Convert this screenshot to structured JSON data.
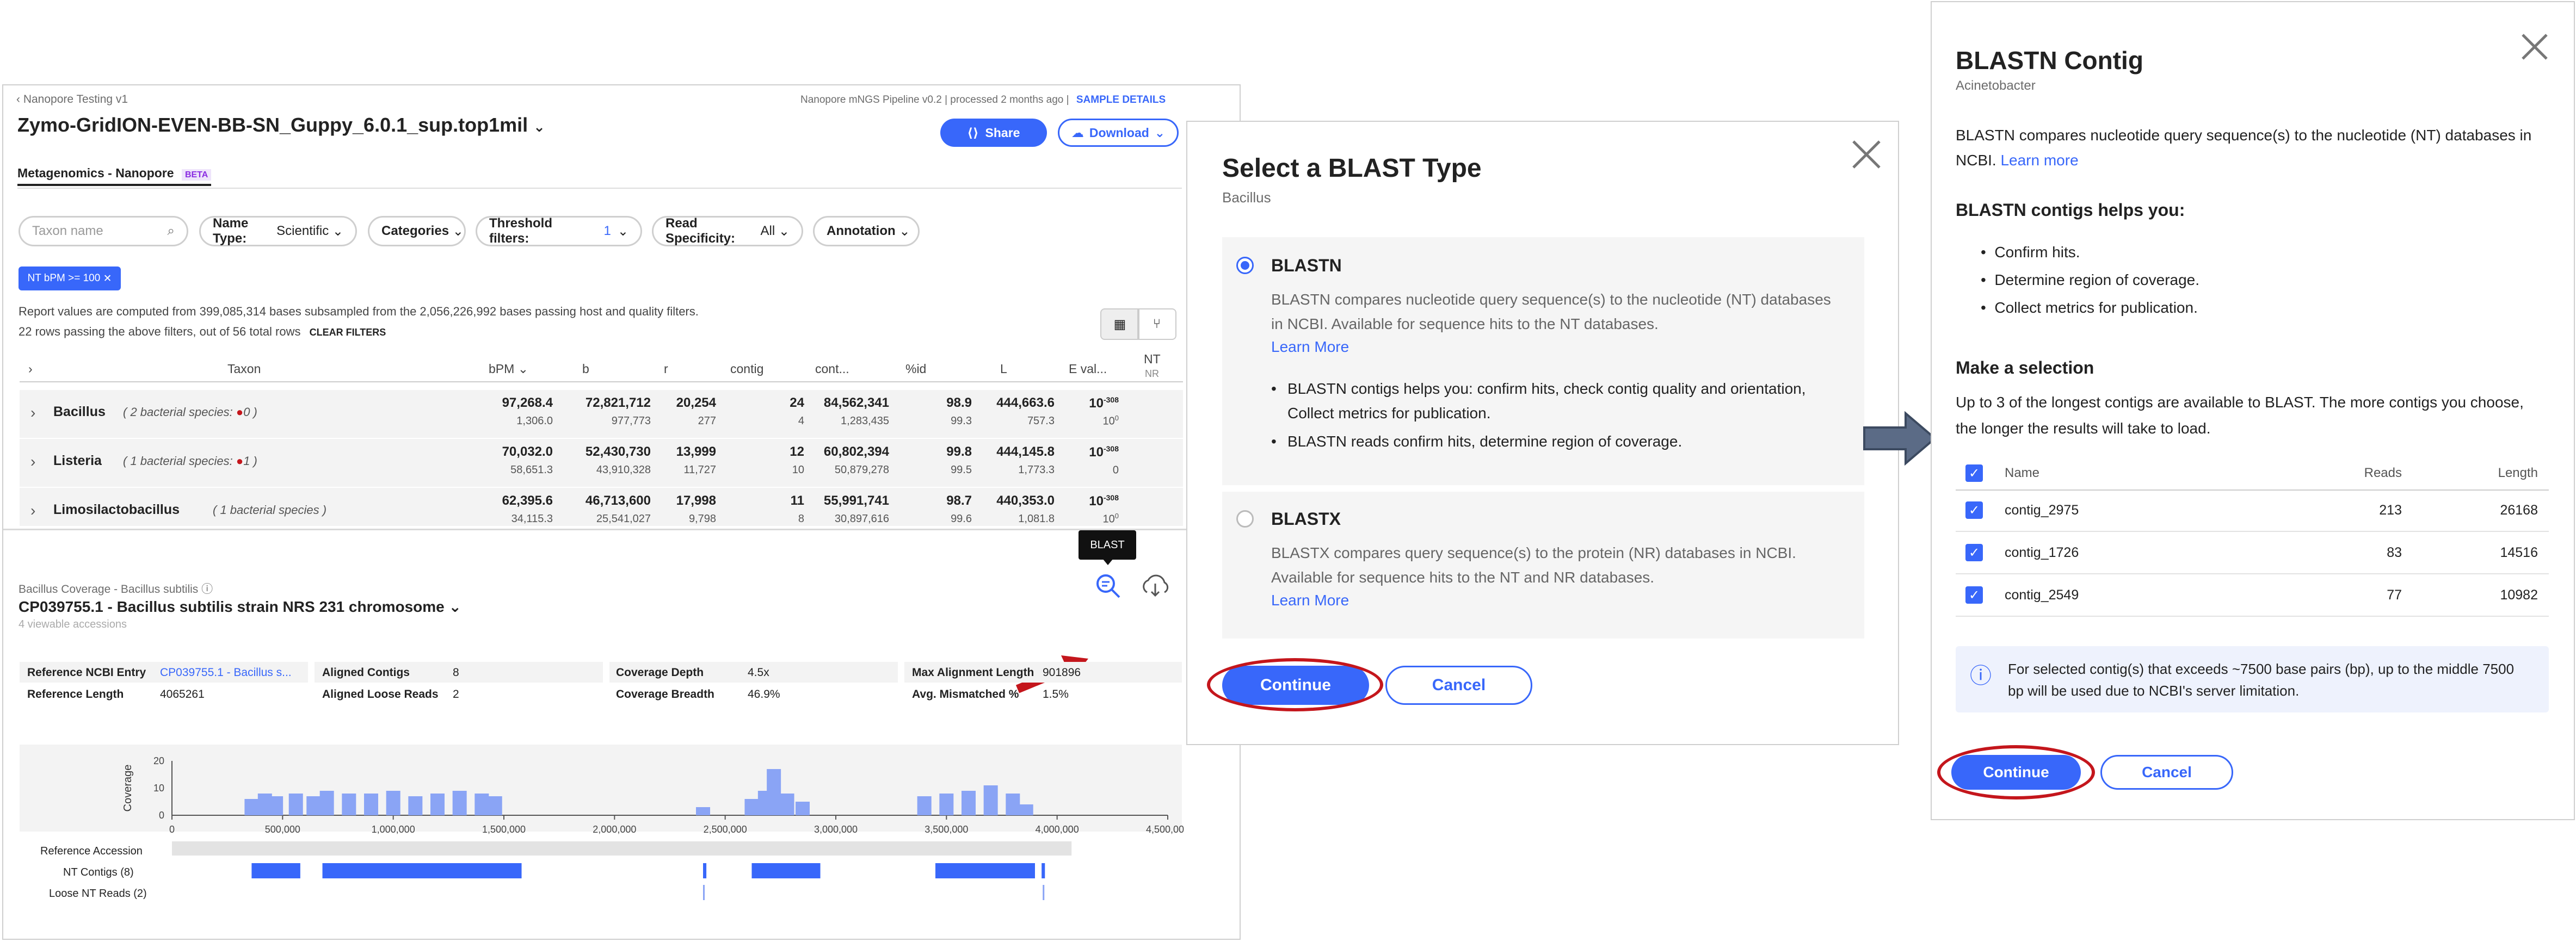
{
  "report": {
    "breadcrumb": "Nanopore Testing v1",
    "title": "Zymo-GridION-EVEN-BB-SN_Guppy_6.0.1_sup.top1mil",
    "pipeline_info": "Nanopore mNGS Pipeline v0.2 | processed 2 months ago |",
    "sample_details": "SAMPLE DETAILS",
    "share_label": "Share",
    "download_label": "Download",
    "tab_label": "Metagenomics - Nanopore",
    "tab_badge": "BETA",
    "search_placeholder": "Taxon name",
    "filters": {
      "name_type_key": "Name Type:",
      "name_type_val": "Scientific",
      "categories": "Categories",
      "threshold_key": "Threshold filters:",
      "threshold_count": "1",
      "read_spec_key": "Read Specificity:",
      "read_spec_val": "All",
      "annotation": "Annotation"
    },
    "active_filter": "NT bPM >= 100",
    "info_line1": "Report values are computed from 399,085,314 bases subsampled from the 2,056,226,992 bases passing host and quality filters.",
    "info_line2": "22 rows passing the above filters, out of 56 total rows",
    "clear_filters": "CLEAR FILTERS",
    "columns": [
      "Taxon",
      "bPM",
      "b",
      "r",
      "contig",
      "cont...",
      "%id",
      "L",
      "E val...",
      "NT",
      "NR"
    ],
    "rows": [
      {
        "name": "Bacillus",
        "species": "( 2 bacterial species:",
        "count": "0 )",
        "bpm": "97,268.4",
        "bpm2": "1,306.0",
        "b": "72,821,712",
        "b2": "977,773",
        "r": "20,254",
        "r2": "277",
        "contig": "24",
        "contig2": "4",
        "cont": "84,562,341",
        "cont2": "1,283,435",
        "pid": "98.9",
        "pid2": "99.3",
        "l": "444,663.6",
        "l2": "757.3",
        "e": "10",
        "e_exp": "-308",
        "e2": "10",
        "e2_exp": "0"
      },
      {
        "name": "Listeria",
        "species": "( 1 bacterial species:",
        "count": "1 )",
        "bpm": "70,032.0",
        "bpm2": "58,651.3",
        "b": "52,430,730",
        "b2": "43,910,328",
        "r": "13,999",
        "r2": "11,727",
        "contig": "12",
        "contig2": "10",
        "cont": "60,802,394",
        "cont2": "50,879,278",
        "pid": "99.8",
        "pid2": "99.5",
        "l": "444,145.8",
        "l2": "1,773.3",
        "e": "10",
        "e_exp": "-308",
        "e2": "0",
        "e2_exp": ""
      },
      {
        "name": "Limosilactobacillus",
        "species": "( 1 bacterial species )",
        "count": "",
        "bpm": "62,395.6",
        "bpm2": "34,115.3",
        "b": "46,713,600",
        "b2": "25,541,027",
        "r": "17,998",
        "r2": "9,798",
        "contig": "11",
        "contig2": "8",
        "cont": "55,991,741",
        "cont2": "30,897,616",
        "pid": "98.7",
        "pid2": "99.6",
        "l": "440,353.0",
        "l2": "1,081.8",
        "e": "10",
        "e_exp": "-308",
        "e2": "10",
        "e2_exp": "0"
      }
    ],
    "coverage": {
      "heading": "Bacillus Coverage - Bacillus subtilis",
      "accession": "CP039755.1 - Bacillus subtilis strain NRS 231 chromosome",
      "viewable": "4 viewable accessions",
      "blast_tooltip": "BLAST",
      "metrics": {
        "ref_entry_key": "Reference NCBI Entry",
        "ref_entry_val": "CP039755.1 - Bacillus s...",
        "aligned_contigs_key": "Aligned Contigs",
        "aligned_contigs_val": "8",
        "depth_key": "Coverage Depth",
        "depth_val": "4.5x",
        "maxlen_key": "Max Alignment Length",
        "maxlen_val": "901896",
        "reflen_key": "Reference Length",
        "reflen_val": "4065261",
        "loose_key": "Aligned Loose Reads",
        "loose_val": "2",
        "breadth_key": "Coverage Breadth",
        "breadth_val": "46.9%",
        "mismatch_key": "Avg. Mismatched %",
        "mismatch_val": "1.5%"
      },
      "track_labels": {
        "ref": "Reference Accession",
        "nt_contigs": "NT Contigs (8)",
        "loose": "Loose NT Reads (2)"
      }
    }
  },
  "chart_data": {
    "type": "area",
    "ylabel": "Coverage",
    "xlabel": "",
    "x_ticks": [
      "0",
      "500,000",
      "1,000,000",
      "1,500,000",
      "2,000,000",
      "2,500,000",
      "3,000,000",
      "3,500,000",
      "4,000,000",
      "4,500,000"
    ],
    "y_ticks": [
      "0",
      "10",
      "20"
    ],
    "xlim": [
      0,
      4500000
    ],
    "ylim": [
      0,
      20
    ],
    "series": [
      {
        "x": [
          360000,
          420000,
          470000,
          560000,
          640000,
          700000,
          800000,
          900000,
          1000000,
          1100000,
          1200000,
          1300000,
          1400000,
          1460000,
          2400000,
          2620000,
          2680000,
          2720000,
          2780000,
          2850000,
          3400000,
          3500000,
          3600000,
          3700000,
          3800000,
          3860000
        ],
        "y": [
          6,
          8,
          7,
          8,
          7,
          9,
          8,
          8,
          9,
          7,
          8,
          9,
          8,
          7,
          3,
          6,
          9,
          17,
          8,
          5,
          7,
          8,
          9,
          11,
          8,
          4
        ]
      }
    ],
    "tracks": {
      "reference": [
        [
          0,
          4065261
        ]
      ],
      "nt_contigs": [
        [
          360000,
          580000
        ],
        [
          680000,
          1580000
        ],
        [
          2400000,
          2415000
        ],
        [
          2620000,
          2930000
        ],
        [
          3450000,
          3900000
        ],
        [
          3930000,
          3945000
        ]
      ],
      "loose_reads": [
        [
          2400000,
          2405000
        ],
        [
          3935000,
          3940000
        ]
      ]
    }
  },
  "blast_type_modal": {
    "title": "Select a BLAST Type",
    "subtitle": "Bacillus",
    "blastn_title": "BLASTN",
    "blastn_desc": "BLASTN compares nucleotide query sequence(s) to the nucleotide (NT) databases in NCBI. Available for sequence hits to the NT databases.",
    "blastn_learn": "Learn More",
    "blastn_bullet1": "BLASTN contigs helps you: confirm hits, check contig quality and orientation, Collect metrics for publication.",
    "blastn_bullet2": "BLASTN reads confirm hits, determine region of coverage.",
    "blastx_title": "BLASTX",
    "blastx_desc": "BLASTX compares query sequence(s) to the protein (NR) databases in NCBI. Available for sequence hits to the NT and NR databases.",
    "blastx_learn": "Learn More",
    "continue_label": "Continue",
    "cancel_label": "Cancel"
  },
  "blastn_contig_modal": {
    "title": "BLASTN Contig",
    "subtitle": "Acinetobacter",
    "desc": "BLASTN compares nucleotide query sequence(s) to the nucleotide (NT) databases in NCBI.",
    "learn_more": "Learn more",
    "helps_heading": "BLASTN contigs helps you:",
    "helps": [
      "Confirm hits.",
      "Determine region of coverage.",
      "Collect metrics for publication."
    ],
    "selection_heading": "Make a selection",
    "selection_desc": "Up to 3 of the longest contigs are available to BLAST. The more contigs you choose, the longer the results will take to load.",
    "table_headers": {
      "name": "Name",
      "reads": "Reads",
      "length": "Length"
    },
    "contigs": [
      {
        "name": "contig_2975",
        "reads": "213",
        "length": "26168"
      },
      {
        "name": "contig_1726",
        "reads": "83",
        "length": "14516"
      },
      {
        "name": "contig_2549",
        "reads": "77",
        "length": "10982"
      }
    ],
    "notice": "For selected contig(s) that exceeds ~7500 base pairs (bp), up to the middle 7500 bp will be used due to NCBI's server limitation.",
    "continue_label": "Continue",
    "cancel_label": "Cancel"
  },
  "colors": {
    "accent": "#3867fa",
    "annotation_red": "#c4161c",
    "arrow_gray": "#5b6b86"
  }
}
